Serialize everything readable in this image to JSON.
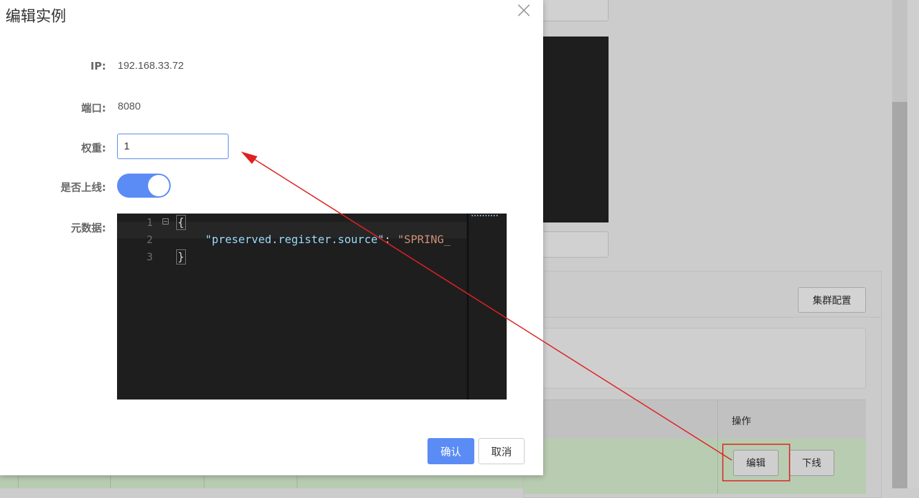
{
  "background": {
    "cluster_config_label": "集群配置",
    "table_header_ops": "操作",
    "row_edit_label": "编辑",
    "row_offline_label": "下线"
  },
  "dialog": {
    "title": "编辑实例",
    "ip_label": "IP:",
    "ip_value": "192.168.33.72",
    "port_label": "端口:",
    "port_value": "8080",
    "weight_label": "权重:",
    "weight_value": "1",
    "online_label": "是否上线:",
    "online": true,
    "metadata_label": "元数据:",
    "editor": {
      "line_numbers": [
        "1",
        "2",
        "3"
      ],
      "open_brace": "{",
      "close_brace": "}",
      "key": "\"preserved.register.source\"",
      "colon": ": ",
      "value": "\"SPRING_"
    },
    "confirm_label": "确认",
    "cancel_label": "取消"
  },
  "colors": {
    "primary": "#5b8cf5",
    "annotation": "#e02020",
    "editor_bg": "#1e1e1e"
  }
}
